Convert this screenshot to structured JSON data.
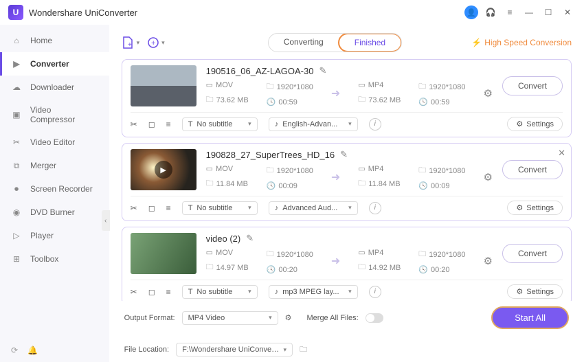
{
  "app": {
    "title": "Wondershare UniConverter"
  },
  "sidebar": {
    "items": [
      {
        "label": "Home"
      },
      {
        "label": "Converter"
      },
      {
        "label": "Downloader"
      },
      {
        "label": "Video Compressor"
      },
      {
        "label": "Video Editor"
      },
      {
        "label": "Merger"
      },
      {
        "label": "Screen Recorder"
      },
      {
        "label": "DVD Burner"
      },
      {
        "label": "Player"
      },
      {
        "label": "Toolbox"
      }
    ]
  },
  "toolbar": {
    "tabs": {
      "converting": "Converting",
      "finished": "Finished"
    },
    "highspeed": "High Speed Conversion"
  },
  "files": [
    {
      "name": "190516_06_AZ-LAGOA-30",
      "src": {
        "fmt": "MOV",
        "res": "1920*1080",
        "size": "73.62 MB",
        "dur": "00:59"
      },
      "dst": {
        "fmt": "MP4",
        "res": "1920*1080",
        "size": "73.62 MB",
        "dur": "00:59"
      },
      "sub": "No subtitle",
      "audio": "English-Advan...",
      "convert": "Convert",
      "settings": "Settings"
    },
    {
      "name": "190828_27_SuperTrees_HD_16",
      "src": {
        "fmt": "MOV",
        "res": "1920*1080",
        "size": "11.84 MB",
        "dur": "00:09"
      },
      "dst": {
        "fmt": "MP4",
        "res": "1920*1080",
        "size": "11.84 MB",
        "dur": "00:09"
      },
      "sub": "No subtitle",
      "audio": "Advanced Aud...",
      "convert": "Convert",
      "settings": "Settings"
    },
    {
      "name": "video (2)",
      "src": {
        "fmt": "MOV",
        "res": "1920*1080",
        "size": "14.97 MB",
        "dur": "00:20"
      },
      "dst": {
        "fmt": "MP4",
        "res": "1920*1080",
        "size": "14.92 MB",
        "dur": "00:20"
      },
      "sub": "No subtitle",
      "audio": "mp3 MPEG lay...",
      "convert": "Convert",
      "settings": "Settings"
    }
  ],
  "footer": {
    "outputFormatLabel": "Output Format:",
    "outputFormat": "MP4 Video",
    "mergeLabel": "Merge All Files:",
    "fileLocationLabel": "File Location:",
    "fileLocation": "F:\\Wondershare UniConverter",
    "startAll": "Start All"
  }
}
